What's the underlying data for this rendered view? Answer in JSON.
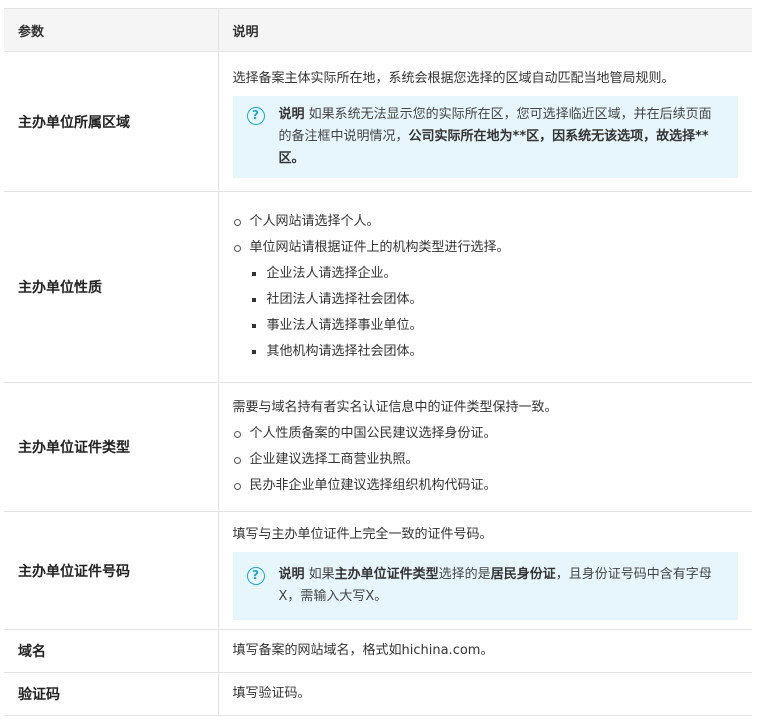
{
  "header": {
    "col_param": "参数",
    "col_desc": "说明"
  },
  "rows": [
    {
      "param": "主办单位所属区域",
      "text": "选择备案主体实际所在地，系统会根据您选择的区域自动匹配当地管局规则。",
      "note": {
        "label": "说明",
        "t1": " 如果系统无法显示您的实际所在区，您可选择临近区域，并在后续页面的备注框中说明情况，",
        "bold": "公司实际所在地为**区，因系统无该选项，故选择**区。"
      }
    },
    {
      "param": "主办单位性质",
      "items": [
        "个人网站请选择个人。",
        "单位网站请根据证件上的机构类型进行选择。"
      ],
      "subitems": [
        "企业法人请选择企业。",
        "社团法人请选择社会团体。",
        "事业法人请选择事业单位。",
        "其他机构请选择社会团体。"
      ]
    },
    {
      "param": "主办单位证件类型",
      "text": "需要与域名持有者实名认证信息中的证件类型保持一致。",
      "items": [
        "个人性质备案的中国公民建议选择身份证。",
        "企业建议选择工商营业执照。",
        "民办非企业单位建议选择组织机构代码证。"
      ]
    },
    {
      "param": "主办单位证件号码",
      "text": "填写与主办单位证件上完全一致的证件号码。",
      "note": {
        "label": "说明",
        "t1": " 如果",
        "b1": "主办单位证件类型",
        "t2": "选择的是",
        "b2": "居民身份证",
        "t3": "，且身份证号码中含有字母X，需输入大写X。"
      }
    },
    {
      "param": "域名",
      "text": "填写备案的网站域名，格式如hichina.com。"
    },
    {
      "param": "验证码",
      "text": "填写验证码。"
    }
  ],
  "icons": {
    "note": "question-circle-icon",
    "note_glyph": "?"
  },
  "colors": {
    "note_bg": "#e7f6fd",
    "note_icon": "#1ea6d6",
    "header_bg": "#f5f5f5",
    "border": "#e3e3e3"
  }
}
